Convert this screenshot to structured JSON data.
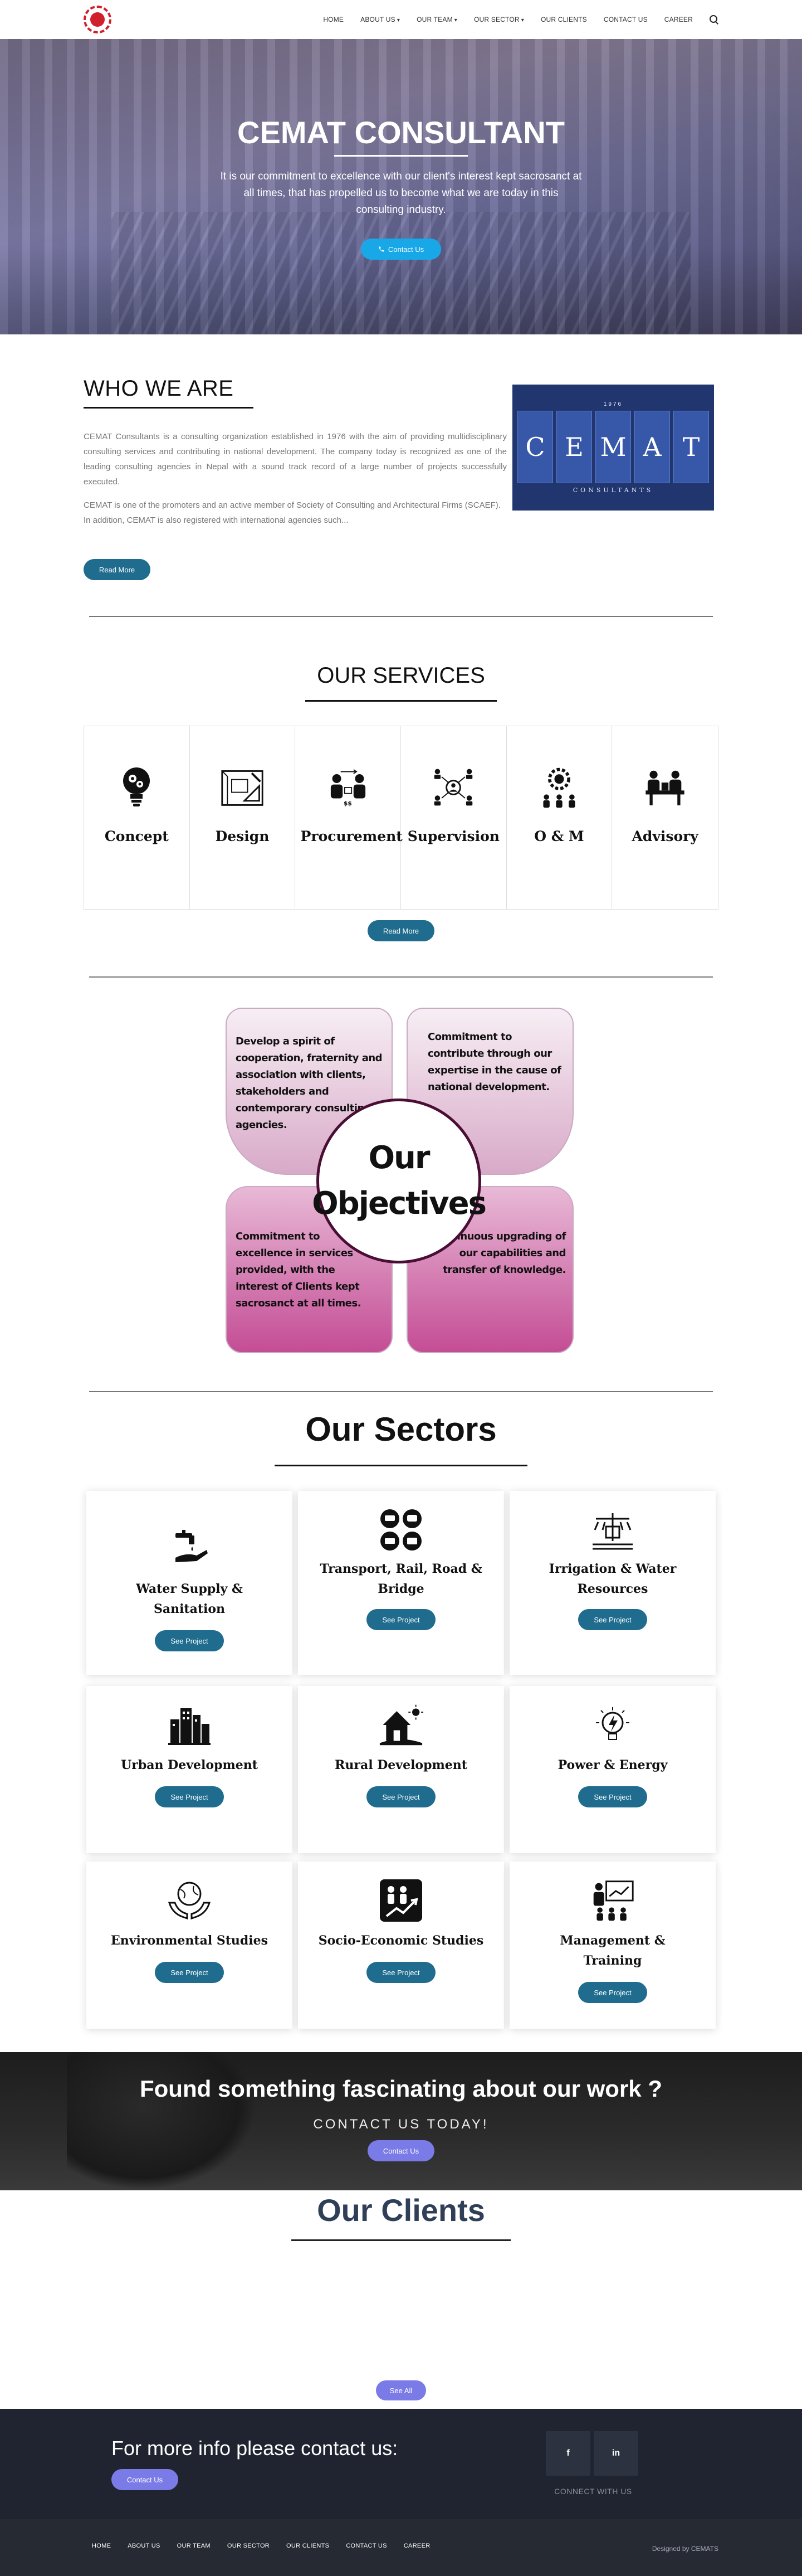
{
  "nav": {
    "items": [
      {
        "label": "HOME",
        "dropdown": false
      },
      {
        "label": "ABOUT US",
        "dropdown": true
      },
      {
        "label": "OUR TEAM",
        "dropdown": true
      },
      {
        "label": "OUR SECTOR",
        "dropdown": true
      },
      {
        "label": "OUR CLIENTS",
        "dropdown": false
      },
      {
        "label": "CONTACT US",
        "dropdown": false
      },
      {
        "label": "CAREER",
        "dropdown": false
      }
    ],
    "search_icon": "search-icon"
  },
  "hero": {
    "title": "CEMAT CONSULTANT",
    "text": "It is our commitment to excellence with our client's interest kept sacrosanct at all times, that has propelled us to become what we are today in this consulting industry.",
    "button": "Contact Us",
    "button_icon": "phone-icon"
  },
  "who": {
    "title": "WHO WE ARE",
    "p1": "CEMAT Consultants is a consulting organization established in 1976 with the aim of providing multidisciplinary consulting services and contributing in national development. The company today is recognized as one of the leading consulting agencies in Nepal with a sound track record of a large number of projects successfully executed.",
    "p2": "CEMAT is one of the promoters and an active member of Society of Consulting and Architectural Firms (SCAEF). In addition, CEMAT is also registered with international agencies such...",
    "button": "Read More",
    "logo": {
      "top": "1976",
      "letters": [
        "C",
        "E",
        "M",
        "A",
        "T"
      ],
      "sub": "CONSULTANTS"
    }
  },
  "services": {
    "title": "OUR SERVICES",
    "items": [
      {
        "label": "Concept",
        "icon": "lightbulb-gears-icon"
      },
      {
        "label": "Design",
        "icon": "blueprint-icon"
      },
      {
        "label": "Procurement",
        "icon": "procurement-people-icon"
      },
      {
        "label": "Supervision",
        "icon": "supervision-network-icon"
      },
      {
        "label": "O & M",
        "icon": "operations-gear-people-icon"
      },
      {
        "label": "Advisory",
        "icon": "advisory-meeting-icon"
      }
    ],
    "button": "Read More"
  },
  "objectives": {
    "title_line1": "Our",
    "title_line2": "Objectives",
    "tl": "Develop a spirit of cooperation, fraternity and association with clients, stakeholders and contemporary consulting agencies.",
    "tr": "Commitment to contribute through our expertise in the cause of national development.",
    "bl": "Commitment to excellence in services provided, with the interest of Clients kept sacrosanct at all times.",
    "br": "Continuous upgrading of our capabilities and transfer of knowledge."
  },
  "sectors": {
    "title": "Our Sectors",
    "button": "See Project",
    "items": [
      {
        "label": "Water Supply & Sanitation",
        "icon": "water-tap-hand-icon"
      },
      {
        "label": "Transport, Rail, Road & Bridge",
        "icon": "transport-vehicles-icon"
      },
      {
        "label": "Irrigation & Water Resources",
        "icon": "irrigation-sprinkler-icon"
      },
      {
        "label": "Urban Development",
        "icon": "city-buildings-icon"
      },
      {
        "label": "Rural Development",
        "icon": "rural-house-icon"
      },
      {
        "label": "Power & Energy",
        "icon": "lightning-bulb-icon"
      },
      {
        "label": "Environmental Studies",
        "icon": "globe-hands-icon"
      },
      {
        "label": "Socio-Economic Studies",
        "icon": "growth-people-icon"
      },
      {
        "label": "Management & Training",
        "icon": "presentation-board-icon"
      }
    ]
  },
  "found": {
    "title": "Found something fascinating about our work ?",
    "sub": "CONTACT US TODAY!",
    "button": "Contact Us"
  },
  "clients": {
    "title": "Our Clients",
    "button": "See All"
  },
  "contact": {
    "title": "For more info please contact us:",
    "button": "Contact Us",
    "social": [
      {
        "label": "f",
        "icon": "facebook-icon"
      },
      {
        "label": "in",
        "icon": "linkedin-icon"
      }
    ],
    "connect": "CONNECT WITH US"
  },
  "footer": {
    "links": [
      "HOME",
      "ABOUT US",
      "OUR TEAM",
      "OUR SECTOR",
      "OUR CLIENTS",
      "CONTACT US",
      "CAREER"
    ],
    "credit": "Designed by CEMATS"
  },
  "colors": {
    "brand_red": "#d0202b",
    "primary_button": "#1f6c8e",
    "hero_button": "#18a8e8",
    "accent_purple": "#7b7be8",
    "cemat_navy": "#21366e"
  }
}
